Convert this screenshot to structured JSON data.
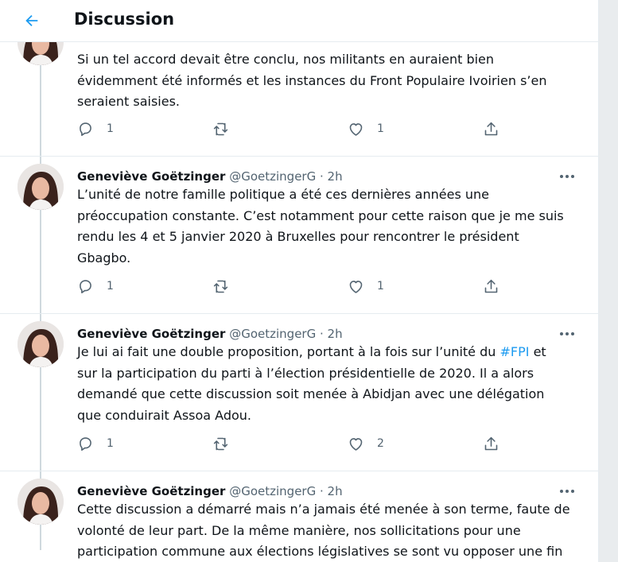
{
  "header": {
    "title": "Discussion"
  },
  "tweets": [
    {
      "lines": [
        "Si un tel accord devait être conclu, nos militants en auraient bien",
        "évidemment été informés et les instances du Front Populaire Ivoirien s’en",
        "seraient saisies."
      ],
      "reply_count": "1",
      "like_count": "1"
    },
    {
      "name": "Geneviève Goëtzinger",
      "handle": "@GoetzingerG",
      "time": "· 2h",
      "lines": [
        "L’unité de notre famille politique a été ces dernières années une",
        "préoccupation constante. C’est notamment pour cette raison que je me suis",
        "rendu les 4 et 5 janvier 2020 à Bruxelles pour rencontrer le président",
        "Gbagbo."
      ],
      "reply_count": "1",
      "like_count": "1"
    },
    {
      "name": "Geneviève Goëtzinger",
      "handle": "@GoetzingerG",
      "time": "· 2h",
      "line1_before": "Je lui ai fait une double proposition, portant à la fois sur l’unité du ",
      "hashtag": "#FPI",
      "line1_after": " et",
      "lines": [
        "sur la participation du parti à l’élection présidentielle de 2020. Il a alors",
        "demandé que cette discussion soit menée à Abidjan avec une délégation",
        "que conduirait Assoa Adou."
      ],
      "reply_count": "1",
      "like_count": "2"
    },
    {
      "name": "Geneviève Goëtzinger",
      "handle": "@GoetzingerG",
      "time": "· 2h",
      "lines": [
        "Cette discussion a démarré mais n’a jamais été menée à son terme, faute de",
        "volonté de leur part. De la même manière, nos sollicitations pour une",
        "participation commune aux élections législatives se sont vu opposer une fin"
      ]
    }
  ],
  "colors": {
    "accent": "#1d9bf0",
    "muted": "#536471",
    "border": "#e6ecf0"
  },
  "icons": [
    "back-arrow-icon",
    "reply-icon",
    "retweet-icon",
    "like-icon",
    "share-icon",
    "more-icon"
  ]
}
